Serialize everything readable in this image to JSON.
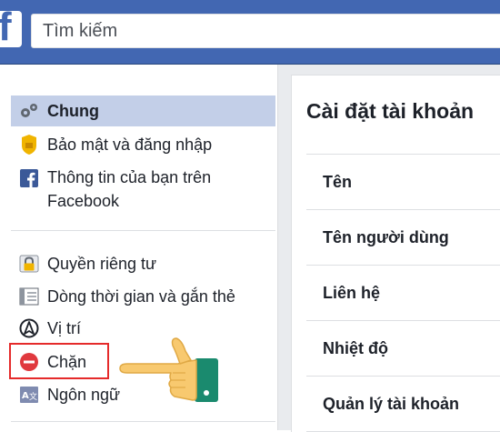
{
  "header": {
    "logo_letter": "f",
    "search_placeholder": "Tìm kiếm"
  },
  "sidebar": {
    "items": [
      {
        "label": "Chung",
        "icon": "gears-icon"
      },
      {
        "label": "Bảo mật và đăng nhập",
        "icon": "shield-icon"
      },
      {
        "label": "Thông tin của bạn trên Facebook",
        "icon": "facebook-icon"
      },
      {
        "label": "Quyền riêng tư",
        "icon": "lock-icon"
      },
      {
        "label": "Dòng thời gian và gắn thẻ",
        "icon": "timeline-icon"
      },
      {
        "label": "Vị trí",
        "icon": "location-icon"
      },
      {
        "label": "Chặn",
        "icon": "block-icon"
      },
      {
        "label": "Ngôn ngữ",
        "icon": "language-icon"
      }
    ],
    "highlighted_item": "Chặn"
  },
  "main": {
    "title": "Cài đặt tài khoản",
    "rows": [
      "Tên",
      "Tên người dùng",
      "Liên hệ",
      "Nhiệt độ",
      "Quản lý tài khoản"
    ]
  },
  "colors": {
    "brand": "#4267b2",
    "active_item_bg": "#c3cfe8",
    "highlight_border": "#e52a2a",
    "hand_skin": "#f8c96f",
    "cuff": "#1a8a6e"
  }
}
